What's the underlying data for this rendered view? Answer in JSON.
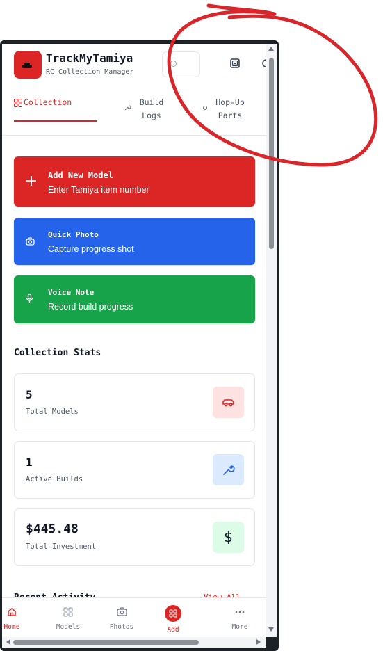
{
  "header": {
    "app_title": "TrackMyTamiya",
    "app_subtitle": "RC Collection Manager",
    "search_placeholder": "",
    "icons": [
      "logo-car-icon",
      "search-icon",
      "gallery-icon",
      "history-icon"
    ]
  },
  "tabs": [
    {
      "label": "Collection",
      "icon": "grid-icon",
      "active": true
    },
    {
      "label": "Build Logs",
      "icon": "wrench-icon",
      "active": false
    },
    {
      "label": "Hop-Up Parts",
      "icon": "gear-icon",
      "active": false
    }
  ],
  "actions": {
    "add": {
      "title": "Add New Model",
      "subtitle": "Enter Tamiya item number",
      "icon": "plus-icon"
    },
    "photo": {
      "title": "Quick Photo",
      "subtitle": "Capture progress shot",
      "icon": "camera-icon"
    },
    "voice": {
      "title": "Voice Note",
      "subtitle": "Record build progress",
      "icon": "microphone-icon"
    }
  },
  "stats": {
    "section_title": "Collection Stats",
    "models": {
      "value": "5",
      "label": "Total Models",
      "icon": "car-icon"
    },
    "builds": {
      "value": "1",
      "label": "Active Builds",
      "icon": "wrench-icon"
    },
    "investment": {
      "value": "$445.48",
      "label": "Total Investment",
      "icon": "dollar-icon",
      "symbol": "$"
    }
  },
  "recent": {
    "title": "Recent Activity",
    "view_all": "View All"
  },
  "bottom_nav": [
    {
      "label": "Home",
      "icon": "home-icon",
      "active": true
    },
    {
      "label": "Models",
      "icon": "grid-icon",
      "active": false
    },
    {
      "label": "Photos",
      "icon": "camera-icon",
      "active": false
    },
    {
      "label": "Add",
      "icon": "add-grid-icon",
      "active": false
    },
    {
      "label": "More",
      "icon": "more-dots-icon",
      "active": false
    }
  ],
  "colors": {
    "brand_red": "#dc2626",
    "photo_blue": "#2563eb",
    "voice_green": "#16a34a",
    "annotation_red": "#d9262b"
  }
}
